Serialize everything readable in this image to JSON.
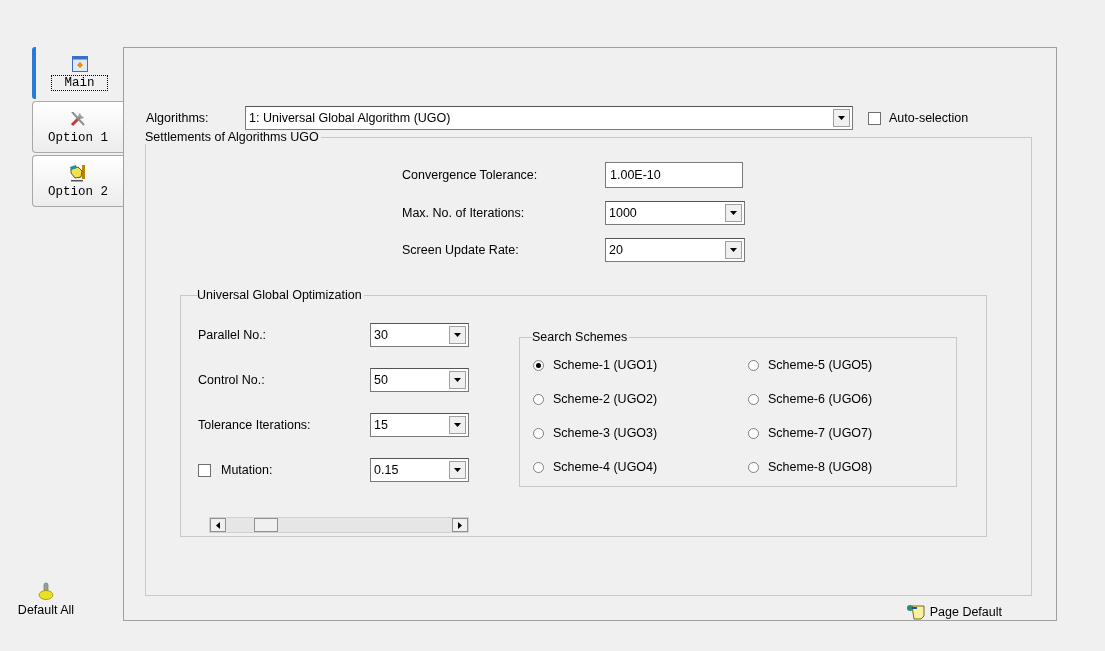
{
  "tabs": [
    {
      "label": "Main",
      "selected": true
    },
    {
      "label": "Option 1",
      "selected": false
    },
    {
      "label": "Option 2",
      "selected": false
    }
  ],
  "default_all": "Default All",
  "algorithms": {
    "label": "Algorithms:",
    "value": "1: Universal Global Algorithm (UGO)"
  },
  "auto_selection": {
    "label": "Auto-selection",
    "checked": false
  },
  "settlements": {
    "title": "Settlements of Algorithms UGO",
    "fields": [
      {
        "label": "Convergence Tolerance:",
        "value": "1.00E-10",
        "kind": "text"
      },
      {
        "label": "Max. No. of Iterations:",
        "value": "1000",
        "kind": "dropdown"
      },
      {
        "label": "Screen Update Rate:",
        "value": "20",
        "kind": "dropdown"
      }
    ]
  },
  "ugo": {
    "title": "Universal Global Optimization",
    "fields": [
      {
        "label": "Parallel No.:",
        "value": "30",
        "kind": "plain"
      },
      {
        "label": "Control No.:",
        "value": "50",
        "kind": "plain"
      },
      {
        "label": "Tolerance Iterations:",
        "value": "15",
        "kind": "plain"
      },
      {
        "label": "Mutation:",
        "value": "0.15",
        "kind": "checkbox",
        "checked": false
      }
    ],
    "schemes": {
      "title": "Search Schemes",
      "options": [
        {
          "label": "Scheme-1 (UGO1)",
          "selected": true
        },
        {
          "label": "Scheme-2 (UGO2)",
          "selected": false
        },
        {
          "label": "Scheme-3 (UGO3)",
          "selected": false
        },
        {
          "label": "Scheme-4 (UGO4)",
          "selected": false
        },
        {
          "label": "Scheme-5 (UGO5)",
          "selected": false
        },
        {
          "label": "Scheme-6 (UGO6)",
          "selected": false
        },
        {
          "label": "Scheme-7 (UGO7)",
          "selected": false
        },
        {
          "label": "Scheme-8 (UGO8)",
          "selected": false
        }
      ]
    }
  },
  "page_default": "Page Default"
}
